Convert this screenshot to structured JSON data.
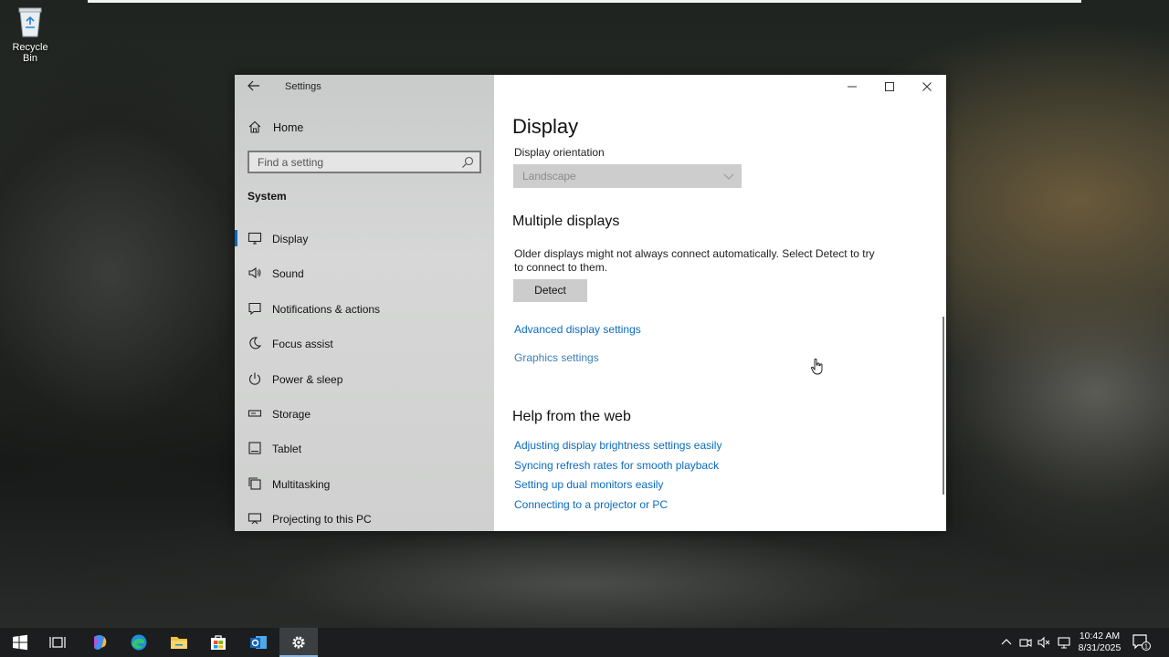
{
  "desktop": {
    "recycle_bin_label": "Recycle Bin"
  },
  "window": {
    "title": "Settings",
    "sidebar": {
      "home_label": "Home",
      "search_placeholder": "Find a setting",
      "section": "System",
      "items": [
        {
          "label": "Display",
          "icon": "monitor-icon",
          "selected": true
        },
        {
          "label": "Sound",
          "icon": "speaker-icon"
        },
        {
          "label": "Notifications & actions",
          "icon": "notification-icon"
        },
        {
          "label": "Focus assist",
          "icon": "moon-icon"
        },
        {
          "label": "Power & sleep",
          "icon": "power-icon"
        },
        {
          "label": "Storage",
          "icon": "storage-icon"
        },
        {
          "label": "Tablet",
          "icon": "tablet-icon"
        },
        {
          "label": "Multitasking",
          "icon": "multitasking-icon"
        },
        {
          "label": "Projecting to this PC",
          "icon": "projecting-icon"
        }
      ]
    },
    "content": {
      "page_title": "Display",
      "orientation_label": "Display orientation",
      "orientation_value": "Landscape",
      "multiple_heading": "Multiple displays",
      "multiple_desc": "Older displays might not always connect automatically. Select Detect to try to connect to them.",
      "detect_label": "Detect",
      "advanced_link": "Advanced display settings",
      "graphics_link": "Graphics settings",
      "help_heading": "Help from the web",
      "help_links": [
        "Adjusting display brightness settings easily",
        "Syncing refresh rates for smooth playback",
        "Setting up dual monitors easily",
        "Connecting to a projector or PC"
      ]
    }
  },
  "taskbar": {
    "time": "10:42 AM",
    "date": "8/31/2025",
    "notification_count": "1",
    "accent_color": "#0067c0"
  }
}
